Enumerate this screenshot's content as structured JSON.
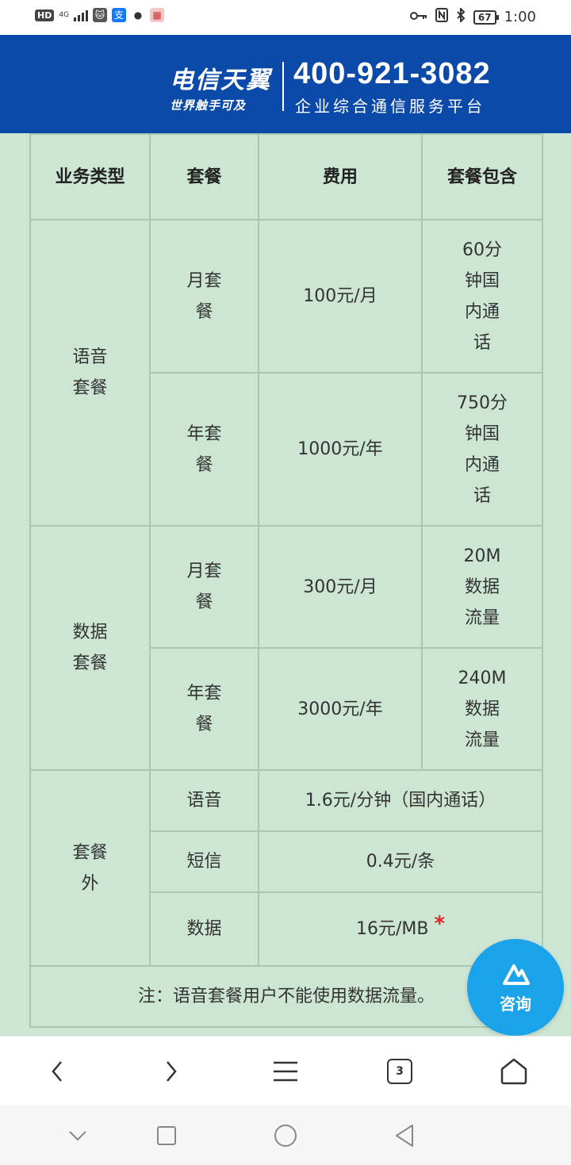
{
  "status_bar": {
    "hd": "HD",
    "network": "4G",
    "time": "1:00",
    "battery": "67"
  },
  "banner": {
    "brand_main": "电信天翼",
    "brand_sub": "世界触手可及",
    "phone": "400-921-3082",
    "platform": "企业综合通信服务平台"
  },
  "table": {
    "headers": [
      "业务类型",
      "套餐",
      "费用",
      "套餐包含"
    ],
    "voice": {
      "type": "语音\n套餐",
      "monthly": {
        "plan": "月套\n餐",
        "fee": "100元/月",
        "includes": "60分\n钟国\n内通\n话"
      },
      "yearly": {
        "plan": "年套\n餐",
        "fee": "1000元/年",
        "includes": "750分\n钟国\n内通\n话"
      }
    },
    "data": {
      "type": "数据\n套餐",
      "monthly": {
        "plan": "月套\n餐",
        "fee": "300元/月",
        "includes": "20M\n数据\n流量"
      },
      "yearly": {
        "plan": "年套\n餐",
        "fee": "3000元/年",
        "includes": "240M\n数据\n流量"
      }
    },
    "extra": {
      "type": "套餐\n外",
      "voice": {
        "plan": "语音",
        "fee": "1.6元/分钟（国内通话）"
      },
      "sms": {
        "plan": "短信",
        "fee": "0.4元/条"
      },
      "data": {
        "plan": "数据",
        "fee": "16元/MB",
        "mark": "*"
      }
    },
    "note": "注：语音套餐用户不能使用数据流量。"
  },
  "consult": {
    "label": "咨询"
  },
  "browser": {
    "tabs_count": "3"
  },
  "colors": {
    "banner": "#0b4aa8",
    "content_bg": "#cde6d4",
    "consult": "#1aa3e8",
    "star": "#e0241f"
  }
}
